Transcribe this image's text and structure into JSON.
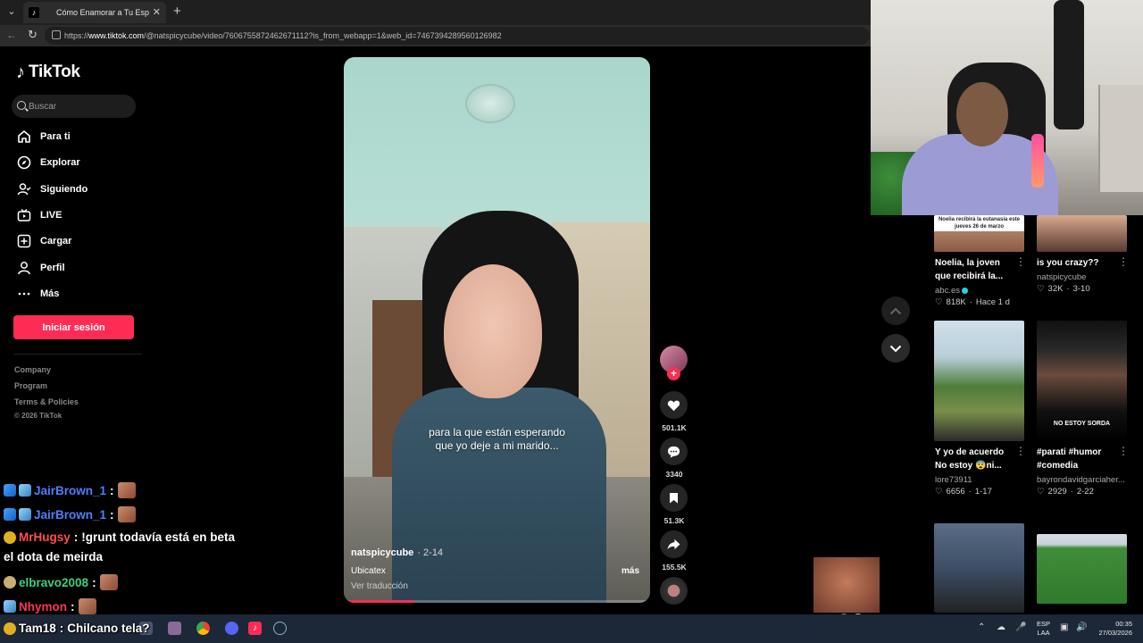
{
  "browser": {
    "tab_title": "Cómo Enamorar a Tu Esposo:",
    "url_prefix": "https://",
    "url_host": "www.tiktok.com",
    "url_path": "/@natspicycube/video/7606755872462671112?is_from_webapp=1&web_id=7467394289560126982"
  },
  "sidebar": {
    "logo_text": "TikTok",
    "search_placeholder": "Buscar",
    "nav": [
      {
        "label": "Para ti",
        "icon": "home-icon"
      },
      {
        "label": "Explorar",
        "icon": "compass-icon"
      },
      {
        "label": "Siguiendo",
        "icon": "following-icon"
      },
      {
        "label": "LIVE",
        "icon": "live-icon"
      },
      {
        "label": "Cargar",
        "icon": "upload-icon"
      },
      {
        "label": "Perfil",
        "icon": "profile-icon"
      },
      {
        "label": "Más",
        "icon": "more-icon"
      }
    ],
    "login_label": "Iniciar sesión",
    "footer": [
      "Company",
      "Program",
      "Terms & Policies",
      "© 2026 TikTok"
    ]
  },
  "video": {
    "caption_line1": "para la que están esperando",
    "caption_line2": "que yo deje a mi marido...",
    "author": "natspicycube",
    "date": "· 2-14",
    "description": "Ubicatex",
    "more_label": "más",
    "translate_label": "Ver traducción",
    "progress": 0.23
  },
  "actions": {
    "likes": "501.1K",
    "comments": "3340",
    "saves": "51.3K",
    "shares": "155.5K"
  },
  "recommended": [
    {
      "title": "Noelia, la joven que recibirá la...",
      "author": "abc.es",
      "verified": true,
      "likes": "818K",
      "when": "Hace 1 d",
      "thumb_text": "Noelia recibirá la eutanasia este jueves 26 de marzo"
    },
    {
      "title": "is you crazy??",
      "author": "natspicycube",
      "verified": false,
      "likes": "32K",
      "when": "3-10",
      "thumb_text": ""
    },
    {
      "title": "Y yo de acuerdo No estoy 😨ni...",
      "author": "lore73911",
      "verified": false,
      "likes": "6656",
      "when": "1-17",
      "thumb_text": ""
    },
    {
      "title": "#parati #humor #comedia",
      "author": "bayrondavidgarciaher...",
      "verified": false,
      "likes": "2929",
      "when": "2-22",
      "thumb_text": "NO ESTOY SORDA"
    }
  ],
  "chat": [
    {
      "user": "JairBrown_1",
      "color": "#4f7dff",
      "msg": "",
      "emote": true
    },
    {
      "user": "JairBrown_1",
      "color": "#4f7dff",
      "msg": "",
      "emote": true
    },
    {
      "user": "MrHugsy",
      "color": "#ff4f4f",
      "msg": "!grunt todavía está en beta",
      "emote": false
    },
    {
      "user": "",
      "color": "#ffffff",
      "msg": "el dota de meirda",
      "emote": false
    },
    {
      "user": "elbravo2008",
      "color": "#3cd17a",
      "msg": "",
      "emote": true
    },
    {
      "user": "Nhymon",
      "color": "#ff3355",
      "msg": "",
      "emote": true
    },
    {
      "user": "Tam18",
      "color": "#ffffff",
      "msg": "Chilcano tela?",
      "emote": false
    }
  ],
  "overlay": {
    "multiplier": "x10"
  },
  "taskbar": {
    "lang_top": "ESP",
    "lang_bottom": "LAA",
    "time": "00:35",
    "date": "27/03/2026"
  },
  "colors": {
    "brand": "#fe2c55",
    "background": "#000000"
  }
}
